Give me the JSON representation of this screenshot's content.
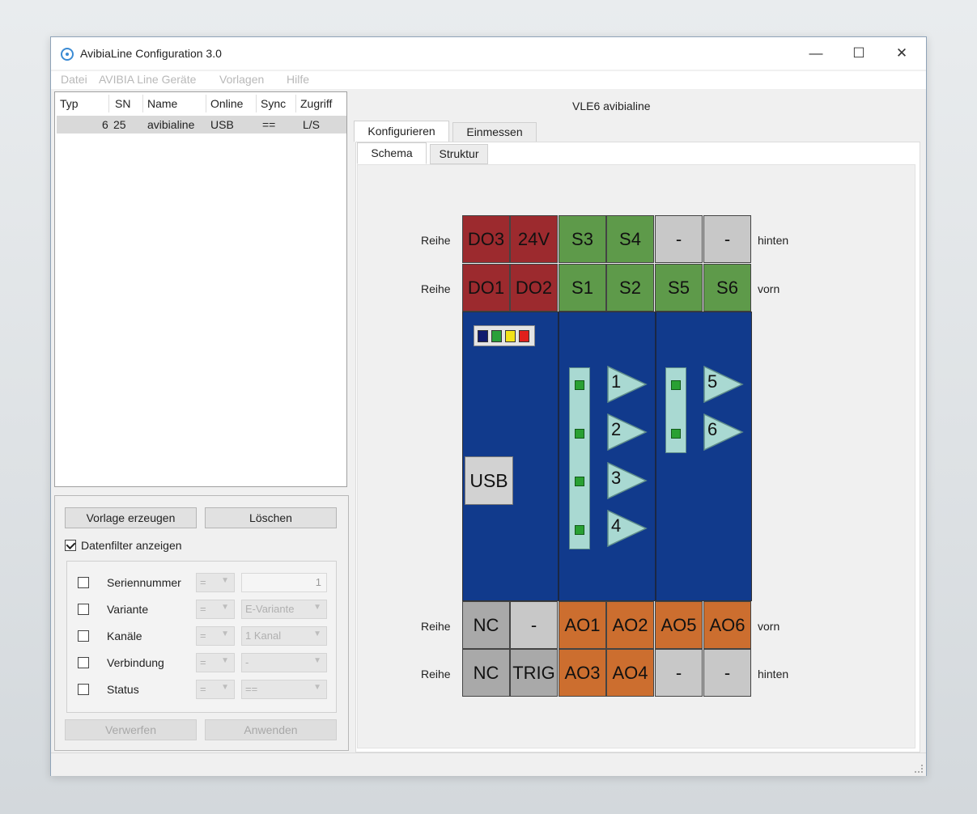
{
  "window": {
    "title": "AvibiaLine Configuration 3.0",
    "minimize_glyph": "—",
    "maximize_glyph": "☐",
    "close_glyph": "✕"
  },
  "menu": {
    "items": [
      "Datei",
      "AVIBIA Line Geräte",
      "Vorlagen",
      "Hilfe"
    ]
  },
  "device_list": {
    "columns": [
      "Typ",
      "SN",
      "Name",
      "Online",
      "Sync",
      "Zugriff"
    ],
    "rows": [
      {
        "typ": "6",
        "sn": "25",
        "name": "avibialine",
        "online": "USB",
        "sync": "==",
        "zugriff": "L/S"
      }
    ]
  },
  "filter_panel": {
    "create_template_label": "Vorlage erzeugen",
    "delete_label": "Löschen",
    "show_filter_label": "Datenfilter anzeigen",
    "show_filter_checked": true,
    "filters": [
      {
        "label": "Seriennummer",
        "op": "=",
        "value": "1",
        "kind": "input"
      },
      {
        "label": "Variante",
        "op": "=",
        "value": "E-Variante",
        "kind": "select"
      },
      {
        "label": "Kanäle",
        "op": "=",
        "value": "1 Kanal",
        "kind": "select"
      },
      {
        "label": "Verbindung",
        "op": "=",
        "value": "-",
        "kind": "select"
      },
      {
        "label": "Status",
        "op": "=",
        "value": "==",
        "kind": "select"
      }
    ],
    "discard_label": "Verwerfen",
    "apply_label": "Anwenden"
  },
  "right_panel": {
    "device_title": "VLE6 avibialine",
    "main_tabs": [
      "Konfigurieren",
      "Einmessen"
    ],
    "sub_tabs": [
      "Schema",
      "Struktur"
    ]
  },
  "schema": {
    "row_label": "Reihe",
    "top_rows": [
      {
        "side": "hinten",
        "terminals": [
          "DO3",
          "24V",
          "S3",
          "S4",
          "-",
          "-"
        ]
      },
      {
        "side": "vorn",
        "terminals": [
          "DO1",
          "DO2",
          "S1",
          "S2",
          "S5",
          "S6"
        ]
      }
    ],
    "bottom_rows": [
      {
        "side": "vorn",
        "terminals": [
          "NC",
          "-",
          "AO1",
          "AO2",
          "AO5",
          "AO6"
        ]
      },
      {
        "side": "hinten",
        "terminals": [
          "NC",
          "TRIG",
          "AO3",
          "AO4",
          "-",
          "-"
        ]
      }
    ],
    "usb_label": "USB",
    "channels_a": [
      "1",
      "2",
      "3",
      "4"
    ],
    "channels_b": [
      "5",
      "6"
    ],
    "colors": {
      "red": "#9c2a2e",
      "green": "#5e9a4a",
      "orange": "#cc6e2f",
      "board": "#113a8c",
      "led_green": "#29a033"
    },
    "status_leds": [
      "#101a6e",
      "#2aa03a",
      "#f2e21a",
      "#e0201c"
    ]
  }
}
